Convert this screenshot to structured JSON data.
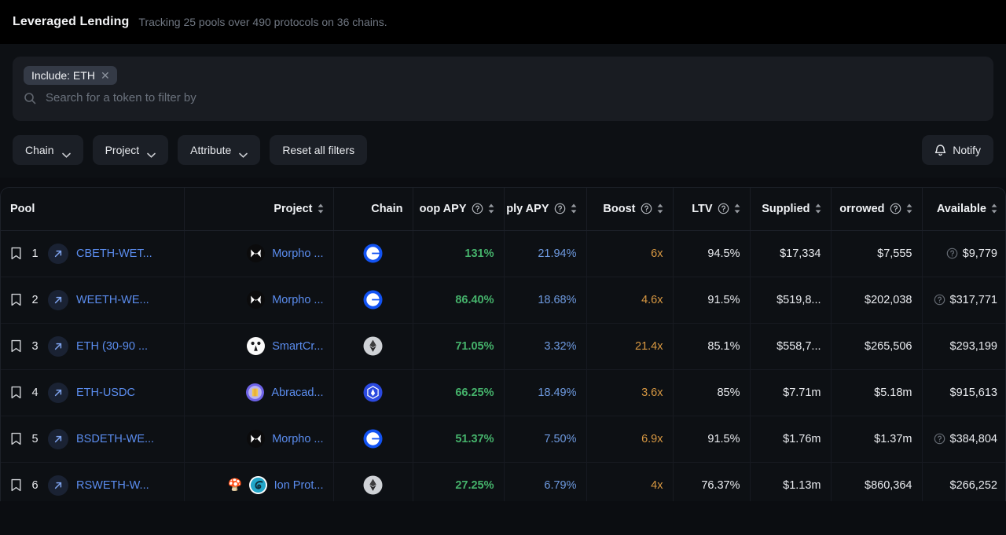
{
  "header": {
    "title": "Leveraged Lending",
    "subtitle": "Tracking 25 pools over 490 protocols on 36 chains."
  },
  "filters": {
    "chips": [
      {
        "label": "Include: ETH",
        "remove_icon": "close-icon"
      }
    ],
    "search": {
      "icon": "search-icon",
      "placeholder": "Search for a token to filter by",
      "value": ""
    },
    "buttons": [
      {
        "label": "Chain",
        "icon": "chevron-down-icon"
      },
      {
        "label": "Project",
        "icon": "chevron-down-icon"
      },
      {
        "label": "Attribute",
        "icon": "chevron-down-icon"
      },
      {
        "label": "Reset all filters",
        "icon": ""
      }
    ],
    "notify": {
      "label": "Notify",
      "icon": "bell-icon"
    }
  },
  "table": {
    "columns": [
      {
        "label": "Pool",
        "align": "left",
        "sortable": false,
        "help": false
      },
      {
        "label": "Project",
        "align": "right",
        "sortable": true,
        "help": false
      },
      {
        "label": "Chain",
        "align": "right",
        "sortable": false,
        "help": false
      },
      {
        "label": "oop APY",
        "align": "right",
        "sortable": true,
        "help": true
      },
      {
        "label": "ply APY",
        "align": "right",
        "sortable": true,
        "help": true
      },
      {
        "label": "Boost",
        "align": "right",
        "sortable": true,
        "help": true
      },
      {
        "label": "LTV",
        "align": "right",
        "sortable": true,
        "help": true
      },
      {
        "label": "Supplied",
        "align": "right",
        "sortable": true,
        "help": false
      },
      {
        "label": "orrowed",
        "align": "right",
        "sortable": true,
        "help": true
      },
      {
        "label": "Available",
        "align": "right",
        "sortable": true,
        "help": false
      }
    ],
    "rows": [
      {
        "rank": "1",
        "bookmark_icon": "bookmark-icon",
        "link_icon": "external-link-icon",
        "pool": "CBETH-WET...",
        "project_emoji": "",
        "project_logo": "morpho-logo",
        "project": "Morpho ...",
        "chain_logo": "base-chain-icon",
        "loop_apy": "131%",
        "supply_apy": "21.94%",
        "boost": "6x",
        "ltv": "94.5%",
        "supplied": "$17,334",
        "borrowed": "$7,555",
        "available": "$9,779",
        "available_help": true
      },
      {
        "rank": "2",
        "bookmark_icon": "bookmark-icon",
        "link_icon": "external-link-icon",
        "pool": "WEETH-WE...",
        "project_emoji": "",
        "project_logo": "morpho-logo",
        "project": "Morpho ...",
        "chain_logo": "base-chain-icon",
        "loop_apy": "86.40%",
        "supply_apy": "18.68%",
        "boost": "4.6x",
        "ltv": "91.5%",
        "supplied": "$519,8...",
        "borrowed": "$202,038",
        "available": "$317,771",
        "available_help": true
      },
      {
        "rank": "3",
        "bookmark_icon": "bookmark-icon",
        "link_icon": "external-link-icon",
        "pool": "ETH (30-90 ...",
        "project_emoji": "",
        "project_logo": "smartcredit-logo",
        "project": "SmartCr...",
        "chain_logo": "ethereum-chain-icon",
        "loop_apy": "71.05%",
        "supply_apy": "3.32%",
        "boost": "21.4x",
        "ltv": "85.1%",
        "supplied": "$558,7...",
        "borrowed": "$265,506",
        "available": "$293,199",
        "available_help": false
      },
      {
        "rank": "4",
        "bookmark_icon": "bookmark-icon",
        "link_icon": "external-link-icon",
        "pool": "ETH-USDC",
        "project_emoji": "",
        "project_logo": "abracadabra-logo",
        "project": "Abracad...",
        "chain_logo": "arbitrum-chain-icon",
        "loop_apy": "66.25%",
        "supply_apy": "18.49%",
        "boost": "3.6x",
        "ltv": "85%",
        "supplied": "$7.71m",
        "borrowed": "$5.18m",
        "available": "$915,613",
        "available_help": false
      },
      {
        "rank": "5",
        "bookmark_icon": "bookmark-icon",
        "link_icon": "external-link-icon",
        "pool": "BSDETH-WE...",
        "project_emoji": "",
        "project_logo": "morpho-logo",
        "project": "Morpho ...",
        "chain_logo": "base-chain-icon",
        "loop_apy": "51.37%",
        "supply_apy": "7.50%",
        "boost": "6.9x",
        "ltv": "91.5%",
        "supplied": "$1.76m",
        "borrowed": "$1.37m",
        "available": "$384,804",
        "available_help": true
      },
      {
        "rank": "6",
        "bookmark_icon": "bookmark-icon",
        "link_icon": "external-link-icon",
        "pool": "RSWETH-W...",
        "project_emoji": "🍄",
        "project_logo": "ion-protocol-logo",
        "project": "Ion Prot...",
        "chain_logo": "ethereum-chain-icon",
        "loop_apy": "27.25%",
        "supply_apy": "6.79%",
        "boost": "4x",
        "ltv": "76.37%",
        "supplied": "$1.13m",
        "borrowed": "$860,364",
        "available": "$266,252",
        "available_help": false
      }
    ]
  },
  "colors": {
    "accent_link": "#5b8def",
    "positive": "#45b26b",
    "supply": "#6e9ae0",
    "boost": "#d89842",
    "background": "#0b0d11",
    "panel": "#191c22"
  }
}
